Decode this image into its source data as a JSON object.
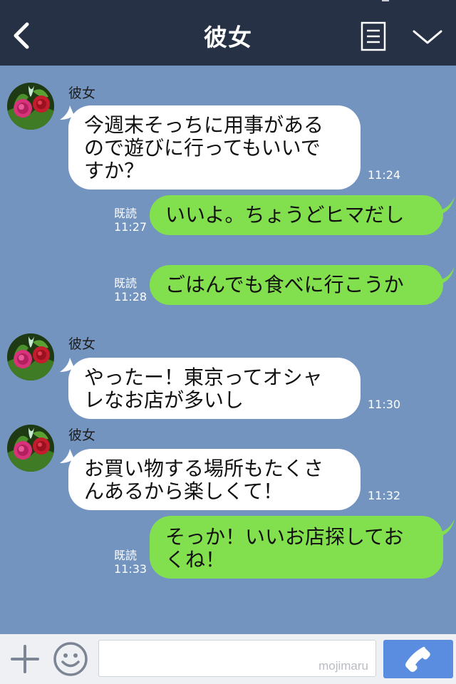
{
  "header": {
    "title": "彼女",
    "back_icon": "chevron-left-icon",
    "menu_icon": "note-list-icon",
    "expand_icon": "chevron-down-icon"
  },
  "messages": [
    {
      "side": "in",
      "sender": "彼女",
      "text": "今週末そっちに用事がある\nので遊びに行ってもいいで\nすか？",
      "time": "11:24"
    },
    {
      "side": "out",
      "read": "既読",
      "text": "いいよ。ちょうどヒマだし",
      "time": "11:27"
    },
    {
      "side": "out",
      "read": "既読",
      "text": "ごはんでも食べに行こうか",
      "time": "11:28"
    },
    {
      "side": "in",
      "sender": "彼女",
      "text": "やったー！東京ってオシャ\nレなお店が多いし",
      "time": "11:30"
    },
    {
      "side": "in",
      "sender": "彼女",
      "text": "お買い物する場所もたくさ\nんあるから楽しくて！",
      "time": "11:32"
    },
    {
      "side": "out",
      "read": "既読",
      "text": "そっか！いいお店探してお\nくね！",
      "time": "11:33"
    }
  ],
  "footer": {
    "input_placeholder": "",
    "watermark": "mojimaru",
    "plus_icon": "plus-icon",
    "sticker_icon": "smiley-icon",
    "call_icon": "phone-icon"
  },
  "colors": {
    "header_bg": "#263145",
    "chat_bg": "#7494c0",
    "outgoing_bubble": "#82df4e",
    "incoming_bubble": "#ffffff",
    "call_button": "#5a8de0"
  }
}
